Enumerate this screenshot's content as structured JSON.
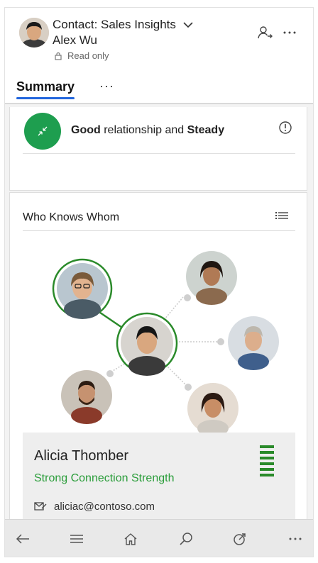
{
  "header": {
    "title": "Contact: Sales Insights",
    "name": "Alex Wu",
    "readonly": "Read only",
    "icons": [
      "assign-user-icon",
      "more-icon"
    ]
  },
  "tabs": {
    "active": "Summary",
    "more": "···"
  },
  "relationship": {
    "quality": "Good",
    "middle": " relationship and ",
    "trend": "Steady",
    "color": "#1e9e4f"
  },
  "who_knows_whom": {
    "title": "Who Knows Whom",
    "contacts": [
      "center-contact",
      "highlighted-contact",
      "contact-top-right",
      "contact-right",
      "contact-bottom-right",
      "contact-bottom-left"
    ],
    "selected": {
      "name": "Alicia Thomber",
      "strength": "Strong Connection Strength",
      "email": "aliciac@contoso.com",
      "strength_color": "#2a9d3a"
    }
  },
  "bottom_nav": {
    "items": [
      "back-icon",
      "menu-icon",
      "home-icon",
      "search-icon",
      "activity-icon",
      "more-icon"
    ]
  }
}
